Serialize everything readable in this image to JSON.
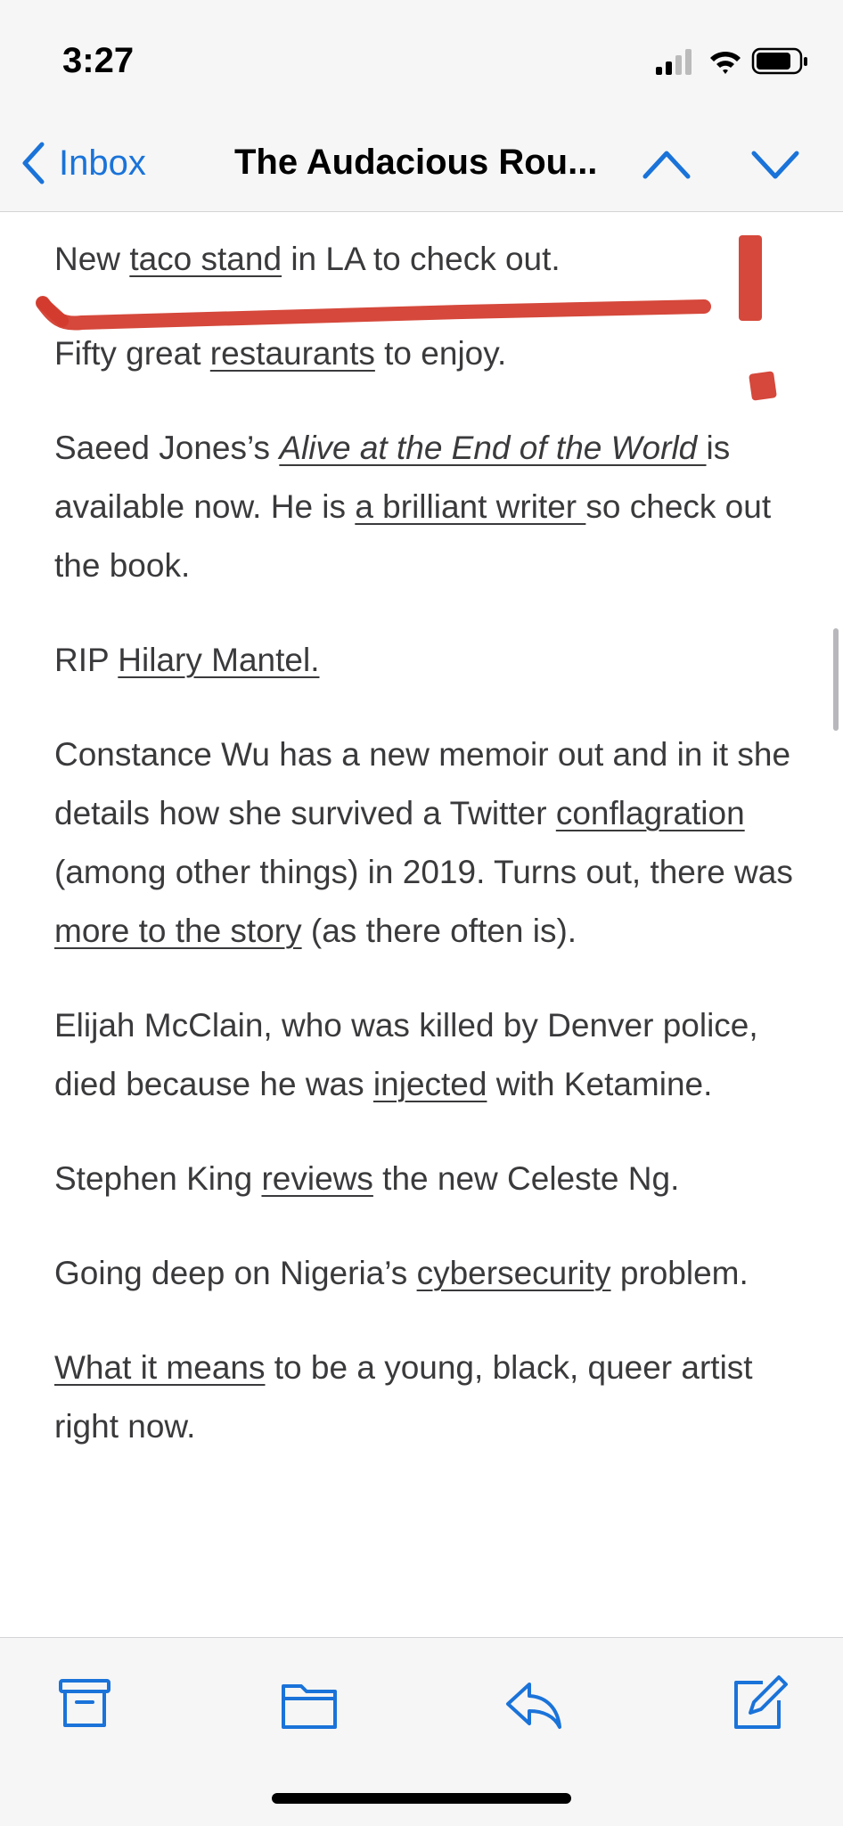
{
  "status_bar": {
    "time": "3:27",
    "icons": [
      "signal-icon",
      "wifi-icon",
      "battery-icon"
    ]
  },
  "nav": {
    "back_label": "Inbox",
    "title": "The Audacious Rou...",
    "prev_icon": "chevron-up-icon",
    "next_icon": "chevron-down-icon"
  },
  "paragraphs": [
    [
      {
        "t": "New "
      },
      {
        "t": "taco stand",
        "link": true
      },
      {
        "t": " in LA to check out."
      }
    ],
    [
      {
        "t": "Fifty great "
      },
      {
        "t": "restaurants",
        "link": true
      },
      {
        "t": " to enjoy."
      }
    ],
    [
      {
        "t": "Saeed Jones’s "
      },
      {
        "t": "Alive at the End of the World ",
        "link": true,
        "italic": true
      },
      {
        "t": "is available now. He is "
      },
      {
        "t": "a brilliant writer ",
        "link": true
      },
      {
        "t": "so check out the book."
      }
    ],
    [
      {
        "t": "RIP "
      },
      {
        "t": "Hilary Mantel.",
        "link": true
      }
    ],
    [
      {
        "t": "Constance Wu has a new memoir out and in it she details how she survived a Twitter "
      },
      {
        "t": "conflagration",
        "link": true
      },
      {
        "t": " (among other things) in 2019. Turns out, there was "
      },
      {
        "t": "more to the story",
        "link": true
      },
      {
        "t": " (as there often is)."
      }
    ],
    [
      {
        "t": "Elijah McClain, who was killed by Denver police, died because he was "
      },
      {
        "t": "injected",
        "link": true
      },
      {
        "t": " with Ketamine."
      }
    ],
    [
      {
        "t": "Stephen King "
      },
      {
        "t": "reviews",
        "link": true
      },
      {
        "t": " the new Celeste Ng."
      }
    ],
    [
      {
        "t": "Going deep on Nigeria’s "
      },
      {
        "t": "cybersecurity",
        "link": true
      },
      {
        "t": " problem."
      }
    ],
    [
      {
        "t": "What it means",
        "link": true
      },
      {
        "t": " to be a young, black, queer artist right now."
      }
    ]
  ],
  "toolbar": {
    "buttons": [
      "archive-icon",
      "folder-icon",
      "reply-icon",
      "compose-icon"
    ]
  },
  "colors": {
    "accent": "#1a73d9",
    "annotation": "#d23a2c",
    "bar_bg": "#f6f6f6",
    "text": "#3a3a3c"
  }
}
